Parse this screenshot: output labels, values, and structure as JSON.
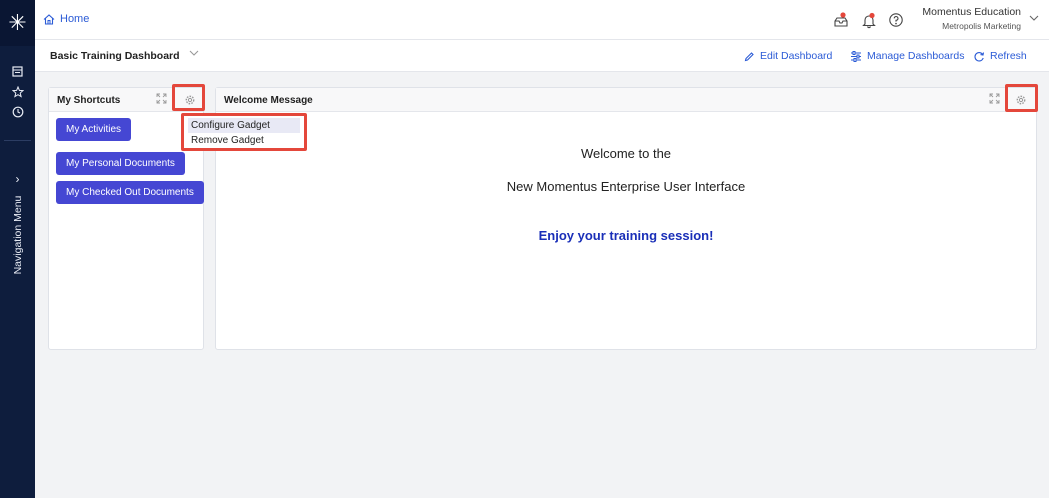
{
  "rail": {
    "logo_glyph": "✳",
    "icons": [
      "dashboard-icon",
      "star-icon",
      "clock-icon"
    ],
    "expand_glyph": "›",
    "nav_menu_label": "Navigation Menu"
  },
  "topbar": {
    "home_label": "Home",
    "user_name": "Momentus Education",
    "user_org": "Metropolis Marketing"
  },
  "dashboard": {
    "title": "Basic Training Dashboard",
    "edit_label": "Edit Dashboard",
    "manage_label": "Manage Dashboards",
    "refresh_label": "Refresh"
  },
  "shortcuts": {
    "title": "My Shortcuts",
    "buttons": [
      "My Activities",
      "My Personal Documents",
      "My Checked Out Documents"
    ]
  },
  "gadget_menu": {
    "items": [
      "Configure Gadget",
      "Remove Gadget"
    ]
  },
  "welcome": {
    "title": "Welcome Message",
    "line1": "Welcome to the",
    "line2": "New Momentus Enterprise User Interface",
    "line3": "Enjoy your training session!"
  },
  "colors": {
    "rail": "#0e1d3d",
    "accent": "#2b5bd6",
    "button": "#4547d3",
    "highlight": "#e4473b",
    "welcome_emphasis": "#1a2fb8"
  }
}
